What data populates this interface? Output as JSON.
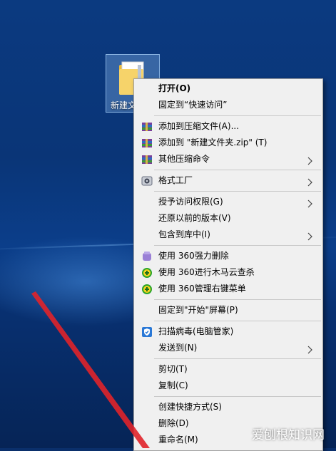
{
  "desktop": {
    "icon_label": "新建文"
  },
  "menu": {
    "items": [
      {
        "label": "打开(O)",
        "bold": true
      },
      {
        "label": "固定到“快速访问”"
      },
      {
        "sep": true
      },
      {
        "label": "添加到压缩文件(A)...",
        "icon": "winrar-icon"
      },
      {
        "label": "添加到 \"新建文件夹.zip\" (T)",
        "icon": "winrar-icon"
      },
      {
        "label": "其他压缩命令",
        "icon": "winrar-icon",
        "submenu": true
      },
      {
        "sep": true
      },
      {
        "label": "格式工厂",
        "icon": "format-factory-icon",
        "submenu": true
      },
      {
        "sep": true
      },
      {
        "label": "授予访问权限(G)",
        "submenu": true
      },
      {
        "label": "还原以前的版本(V)"
      },
      {
        "label": "包含到库中(I)",
        "submenu": true
      },
      {
        "sep": true
      },
      {
        "label": "使用 360强力删除",
        "icon": "360-shred-icon"
      },
      {
        "label": "使用 360进行木马云查杀",
        "icon": "360-trojan-icon"
      },
      {
        "label": "使用 360管理右键菜单",
        "icon": "360-menu-icon"
      },
      {
        "sep": true
      },
      {
        "label": "固定到\"开始\"屏幕(P)"
      },
      {
        "sep": true
      },
      {
        "label": "扫描病毒(电脑管家)",
        "icon": "pc-manager-shield-icon"
      },
      {
        "label": "发送到(N)",
        "submenu": true
      },
      {
        "sep": true
      },
      {
        "label": "剪切(T)"
      },
      {
        "label": "复制(C)"
      },
      {
        "sep": true
      },
      {
        "label": "创建快捷方式(S)"
      },
      {
        "label": "删除(D)"
      },
      {
        "label": "重命名(M)"
      }
    ]
  },
  "watermark": "爱刨根知识网",
  "colors": {
    "menu_bg": "#f0f0f0",
    "desktop_bg": "#0b3a80",
    "pointer_arrow": "#e0232a"
  }
}
